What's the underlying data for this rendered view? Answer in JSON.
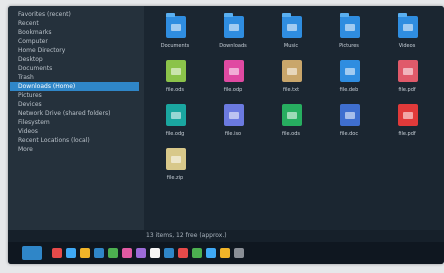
{
  "sidebar": {
    "items": [
      {
        "label": "Favorites (recent)",
        "selected": false
      },
      {
        "label": "Recent",
        "selected": false
      },
      {
        "label": "Bookmarks",
        "selected": false
      },
      {
        "label": "Computer",
        "selected": false
      },
      {
        "label": "Home Directory",
        "selected": false
      },
      {
        "label": "Desktop",
        "selected": false
      },
      {
        "label": "Documents",
        "selected": false
      },
      {
        "label": "Trash",
        "selected": false
      },
      {
        "label": "Downloads (Home)",
        "selected": true
      },
      {
        "label": "Pictures",
        "selected": false
      },
      {
        "label": "Devices",
        "selected": false
      },
      {
        "label": "Network Drive (shared folders)",
        "selected": false
      },
      {
        "label": "Filesystem",
        "selected": false
      },
      {
        "label": "Videos",
        "selected": false
      },
      {
        "label": "Recent Locations (local)",
        "selected": false
      },
      {
        "label": "More",
        "selected": false
      }
    ]
  },
  "files": [
    {
      "name": "Documents",
      "kind": "folder",
      "color": "#2f8de0"
    },
    {
      "name": "Downloads",
      "kind": "folder",
      "color": "#2f8de0"
    },
    {
      "name": "Music",
      "kind": "folder",
      "color": "#2f8de0"
    },
    {
      "name": "Pictures",
      "kind": "folder",
      "color": "#2f8de0"
    },
    {
      "name": "Videos",
      "kind": "folder",
      "color": "#2f8de0"
    },
    {
      "name": "file.ods",
      "kind": "file",
      "color": "#8bc34a"
    },
    {
      "name": "file.odp",
      "kind": "file",
      "color": "#e04aa2"
    },
    {
      "name": "file.txt",
      "kind": "file",
      "color": "#c9a66b"
    },
    {
      "name": "file.deb",
      "kind": "file",
      "color": "#2f8de0"
    },
    {
      "name": "file.pdf",
      "kind": "file",
      "color": "#e05a6a"
    },
    {
      "name": "file.odg",
      "kind": "file",
      "color": "#1aa6a0"
    },
    {
      "name": "file.iso",
      "kind": "file",
      "color": "#6b7ae0"
    },
    {
      "name": "file.ods",
      "kind": "file",
      "color": "#27ae60"
    },
    {
      "name": "file.doc",
      "kind": "file",
      "color": "#3f6fd0"
    },
    {
      "name": "file.pdf",
      "kind": "file",
      "color": "#e03a3a"
    },
    {
      "name": "file.zip",
      "kind": "file",
      "color": "#d8c88a"
    }
  ],
  "status": {
    "text": "13 items, 12 free (approx.)"
  },
  "taskbar_colors": [
    "#e64a4a",
    "#3fa9f5",
    "#f0b429",
    "#2f86c8",
    "#4caf50",
    "#e05aa2",
    "#9c6bd8",
    "#f5f5f5",
    "#2f86c8",
    "#e64a4a",
    "#4caf50",
    "#3fa9f5",
    "#f0b429",
    "#8a8f96"
  ]
}
